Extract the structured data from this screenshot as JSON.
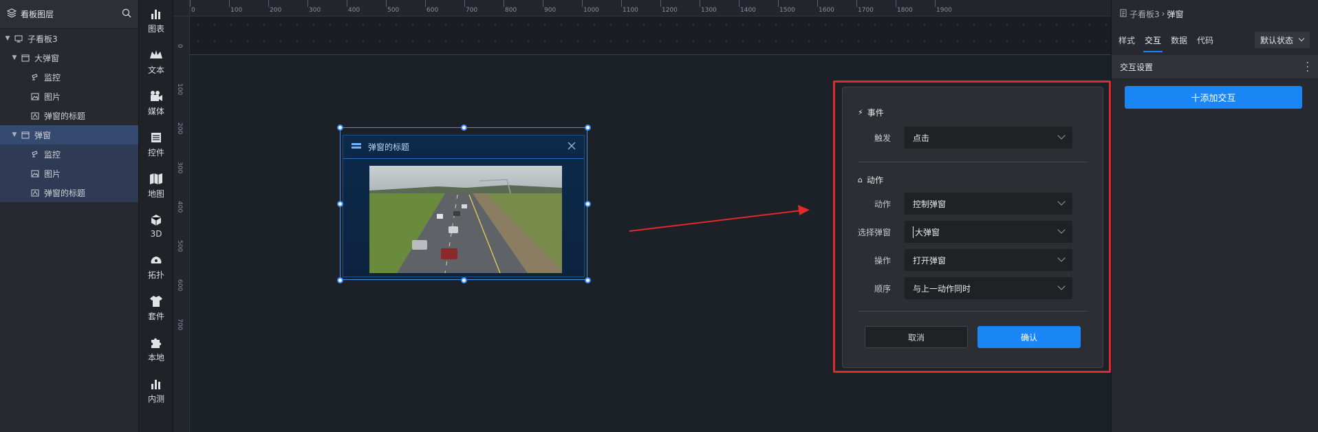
{
  "layers": {
    "title": "看板图层",
    "items": [
      {
        "label": "子看板3"
      },
      {
        "label": "大弹窗"
      },
      {
        "label": "监控"
      },
      {
        "label": "图片"
      },
      {
        "label": "弹窗的标题"
      },
      {
        "label": "弹窗"
      },
      {
        "label": "监控"
      },
      {
        "label": "图片"
      },
      {
        "label": "弹窗的标题"
      }
    ]
  },
  "toolbar": {
    "items": [
      {
        "label": "图表"
      },
      {
        "label": "文本"
      },
      {
        "label": "媒体"
      },
      {
        "label": "控件"
      },
      {
        "label": "地图"
      },
      {
        "label": "3D"
      },
      {
        "label": "拓扑"
      },
      {
        "label": "套件"
      },
      {
        "label": "本地"
      },
      {
        "label": "内测"
      }
    ]
  },
  "ruler": {
    "top": [
      "0",
      "100",
      "200",
      "300",
      "400",
      "500",
      "600",
      "700",
      "800",
      "900",
      "1000",
      "1100",
      "1200",
      "1300",
      "1400",
      "1500",
      "1600",
      "1700",
      "1800",
      "1900"
    ],
    "left": [
      "0",
      "100",
      "200",
      "300",
      "400",
      "500",
      "600",
      "700"
    ]
  },
  "popup": {
    "title": "弹窗的标题"
  },
  "dialog": {
    "event_title": "事件",
    "trigger_label": "触发",
    "trigger_value": "点击",
    "action_title": "动作",
    "action_label": "动作",
    "action_value": "控制弹窗",
    "select_label": "选择弹窗",
    "select_value": "大弹窗",
    "operation_label": "操作",
    "operation_value": "打开弹窗",
    "order_label": "顺序",
    "order_value": "与上一动作同时",
    "cancel_label": "取消",
    "ok_label": "确认"
  },
  "props": {
    "breadcrumb_parent": "子看板3",
    "breadcrumb_current": "弹窗",
    "tabs": [
      "样式",
      "交互",
      "数据",
      "代码"
    ],
    "active_tab": "交互",
    "state_value": "默认状态",
    "section_title": "交互设置",
    "add_button": "十添加交互"
  },
  "colors": {
    "accent": "#1a86f5",
    "highlight": "#e22a2a",
    "selection": "#3a8ef6"
  }
}
